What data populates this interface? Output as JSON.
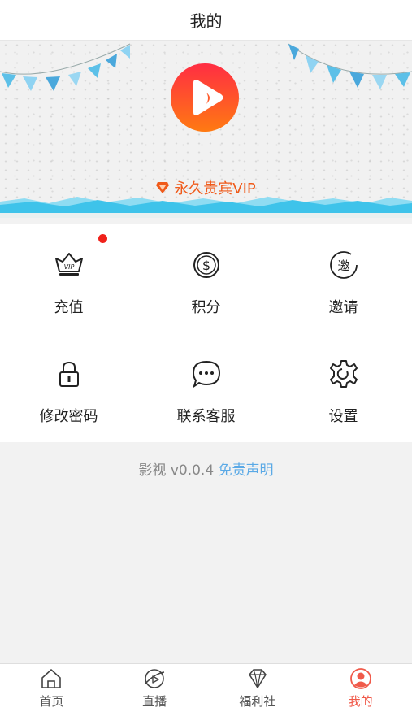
{
  "header": {
    "title": "我的"
  },
  "banner": {
    "vip_label": "永久贵宾VIP",
    "colors": {
      "accent": "#f05a1a",
      "wave": "#3ec3ea"
    }
  },
  "menu": {
    "items": [
      {
        "label": "充值",
        "icon": "vip-crown-icon",
        "badge": true
      },
      {
        "label": "积分",
        "icon": "dollar-coin-icon"
      },
      {
        "label": "邀请",
        "icon": "invite-icon"
      },
      {
        "label": "修改密码",
        "icon": "lock-icon"
      },
      {
        "label": "联系客服",
        "icon": "chat-bubble-icon"
      },
      {
        "label": "设置",
        "icon": "gear-icon"
      }
    ],
    "invite_glyph": "邀"
  },
  "footer": {
    "version": "影视 v0.0.4",
    "disclaimer": "免责声明"
  },
  "tabbar": {
    "active_color": "#f05a4a",
    "items": [
      {
        "label": "首页",
        "icon": "home-icon"
      },
      {
        "label": "直播",
        "icon": "live-icon"
      },
      {
        "label": "福利社",
        "icon": "diamond-icon"
      },
      {
        "label": "我的",
        "icon": "profile-icon",
        "active": true
      }
    ]
  }
}
